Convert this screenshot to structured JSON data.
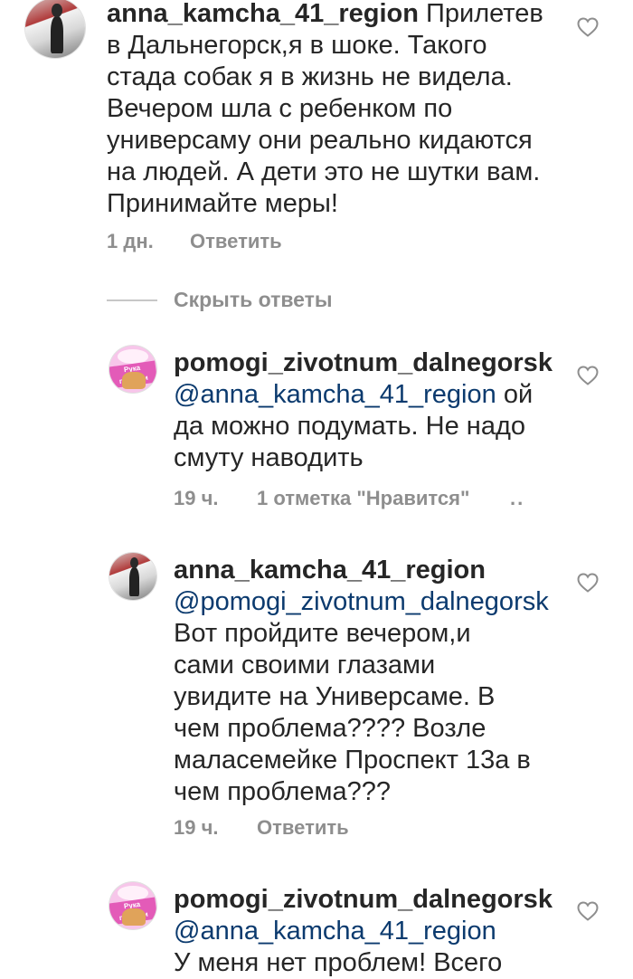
{
  "comments": [
    {
      "username": "anna_kamcha_41_region",
      "body_lines": [
        "Прилетев",
        "в Дальнегорск,я в шоке. Такого",
        "стада собак я в жизнь не видела.",
        "Вечером шла с ребенком по",
        "универсаму они реально кидаются",
        "на людей. А дети это не шутки вам.",
        "Принимайте меры!"
      ],
      "time": "1 дн.",
      "reply_label": "Ответить"
    }
  ],
  "hide_replies_label": "Скрыть ответы",
  "replies": [
    {
      "username": "pomogi_zivotnum_dalnegorsk",
      "mention": "@anna_kamcha_41_region",
      "body_first_tail": " ой",
      "body_lines": [
        "да можно подумать. Не надо",
        "смуту наводить"
      ],
      "time": "19 ч.",
      "likes": "1 отметка \"Нравится\"",
      "more": "..",
      "avatar_stamp": "Рука помощи"
    },
    {
      "username": "anna_kamcha_41_region",
      "mention": "@pomogi_zivotnum_dalnegorsk",
      "body_lines": [
        "Вот пройдите вечером,и",
        "сами своими глазами",
        "увидите на Универсаме. В",
        "чем проблема???? Возле",
        "маласемейке Проспект 13а в",
        "чем проблема???"
      ],
      "time": "19 ч.",
      "reply_label": "Ответить"
    },
    {
      "username": "pomogi_zivotnum_dalnegorsk",
      "mention": "@anna_kamcha_41_region",
      "body_lines": [
        "У меня нет проблем! Всего"
      ],
      "avatar_stamp": "Рука помощи"
    }
  ],
  "icons": {
    "heart": "heart-outline-icon"
  },
  "colors": {
    "text": "#262626",
    "meta": "#8e8e8e",
    "mention": "#0b3a6e",
    "background": "#ffffff"
  }
}
